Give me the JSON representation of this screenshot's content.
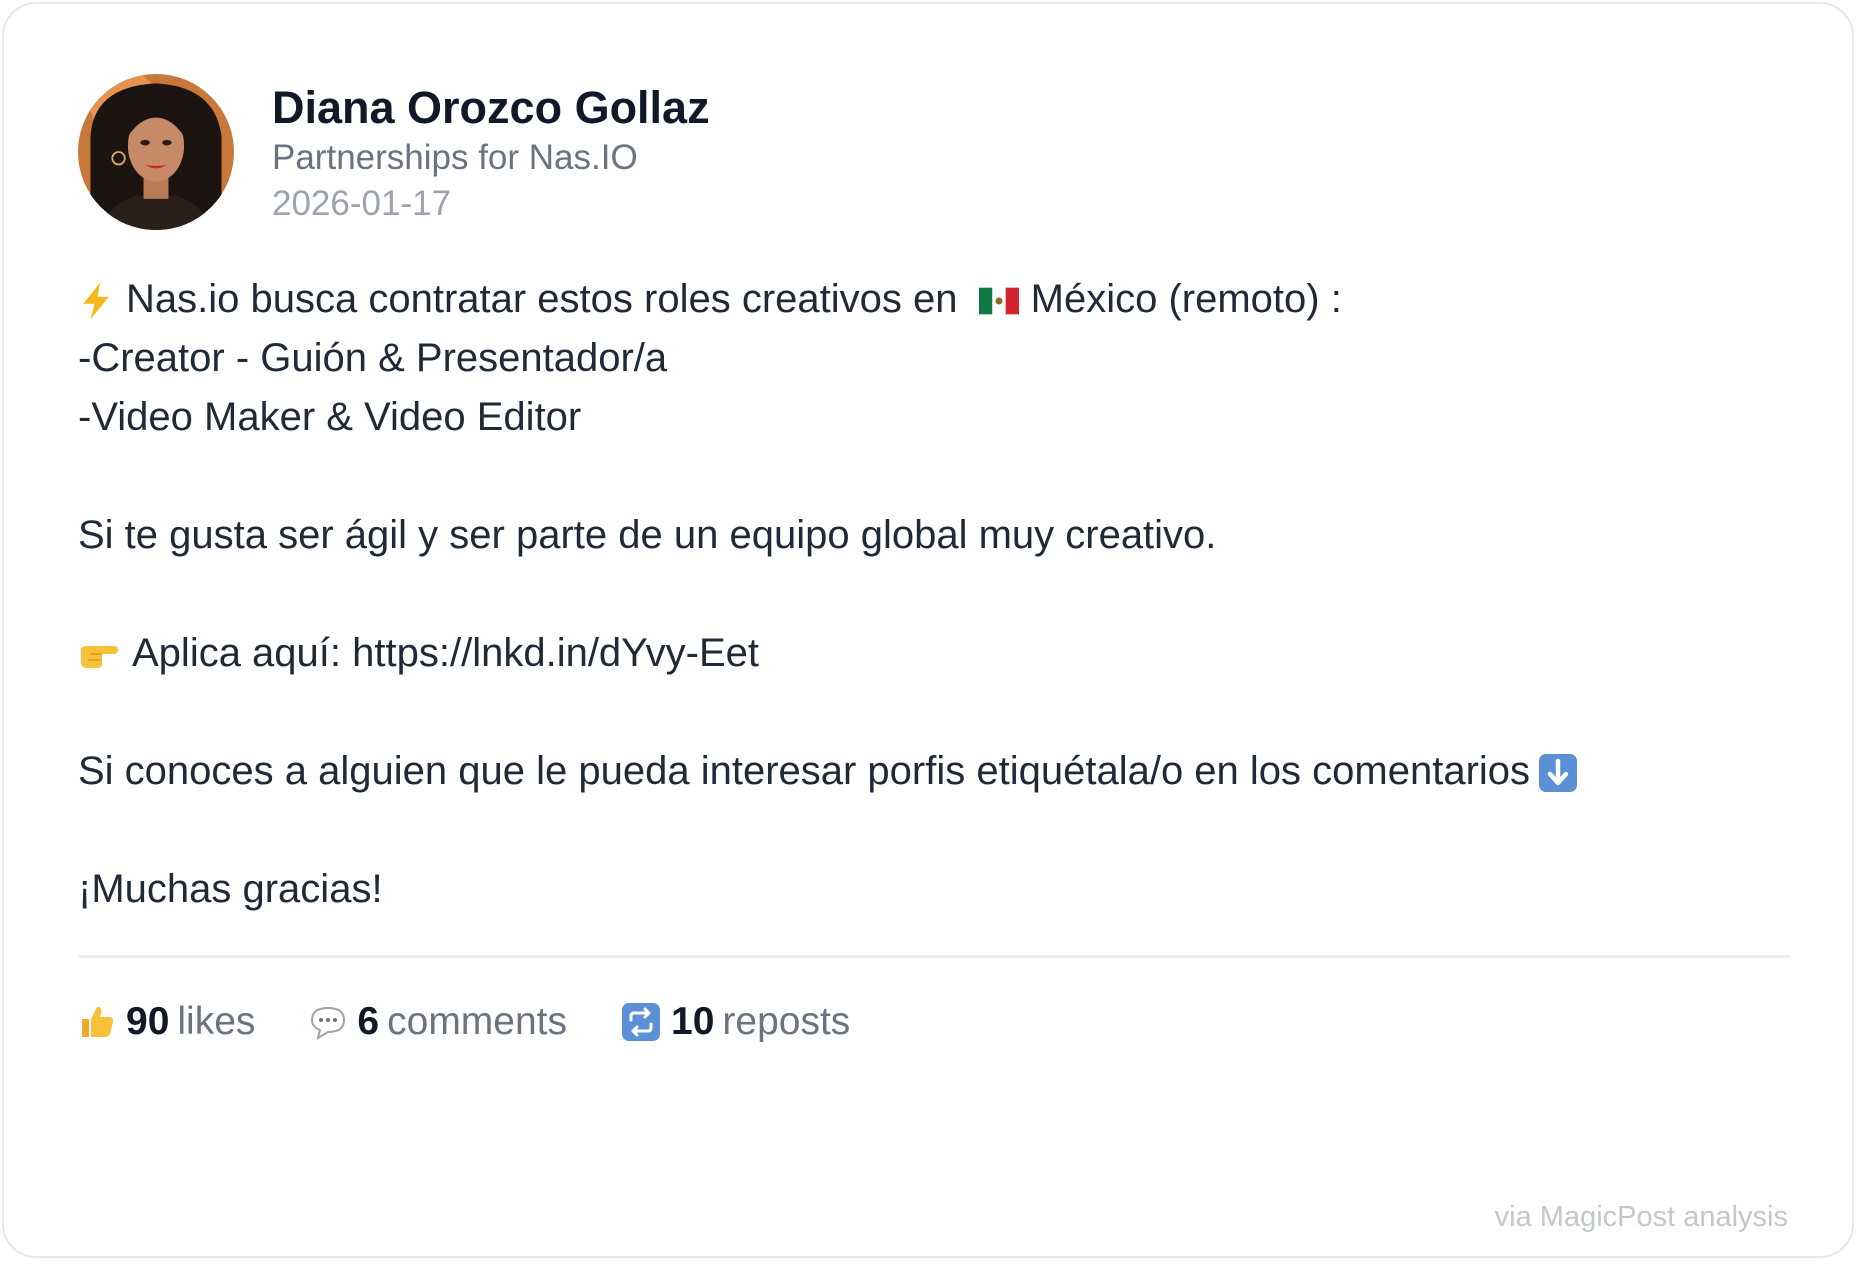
{
  "author": {
    "name": "Diana Orozco Gollaz",
    "headline": "Partnerships for Nas.IO",
    "date": "2026-01-17"
  },
  "post": {
    "lines": [
      {
        "emoji": "lightning-icon",
        "text": "Nas.io busca contratar estos roles creativos en",
        "flag": "mexico-flag-icon",
        "text_after": "México (remoto) :"
      },
      {
        "text": "-Creator - Guión & Presentador/a"
      },
      {
        "text": "-Video Maker & Video Editor"
      },
      {
        "text": ""
      },
      {
        "text": "Si te gusta ser ágil y ser parte de un equipo global muy creativo."
      },
      {
        "text": ""
      },
      {
        "emoji": "pointing-hand-icon",
        "text": "Aplica aquí: https://lnkd.in/dYvy-Eet"
      },
      {
        "text": ""
      },
      {
        "text": "Si conoces a alguien que le pueda interesar porfis etiquétala/o en los comentarios",
        "emoji_after": "down-arrow-icon"
      },
      {
        "text": ""
      },
      {
        "text": "¡Muchas gracias!"
      }
    ]
  },
  "stats": {
    "likes": {
      "icon": "thumbs-up-icon",
      "count": "90",
      "label": "likes"
    },
    "comments": {
      "icon": "speech-bubble-icon",
      "count": "6",
      "label": "comments"
    },
    "reposts": {
      "icon": "repost-icon",
      "count": "10",
      "label": "reposts"
    }
  },
  "footer": {
    "text": "via MagicPost analysis"
  },
  "colors": {
    "name": "#111827",
    "muted": "#6b7280",
    "date": "#9ca3af",
    "body": "#1f2937",
    "footer": "#c2c7ce",
    "repost_badge": "#5b8fd6"
  }
}
